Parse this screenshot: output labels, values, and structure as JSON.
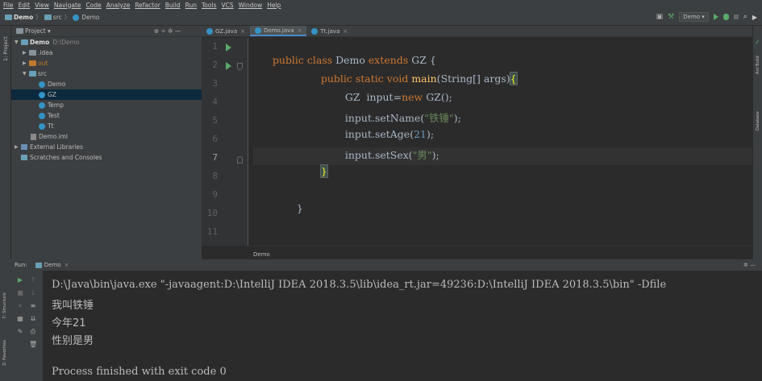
{
  "menu": [
    "File",
    "Edit",
    "View",
    "Navigate",
    "Code",
    "Analyze",
    "Refactor",
    "Build",
    "Run",
    "Tools",
    "VCS",
    "Window",
    "Help"
  ],
  "breadcrumb": {
    "project": "Demo",
    "folder": "src",
    "file": "Demo"
  },
  "toolbar": {
    "run_config": "Demo ▾"
  },
  "project_panel": {
    "title": "Project ▾",
    "icons": "⊕ ÷ ✲ —",
    "tree": [
      {
        "label": "Demo",
        "extra": "D:\\Demo"
      },
      {
        "label": ".idea"
      },
      {
        "label": "out"
      },
      {
        "label": "src"
      },
      {
        "label": "Demo"
      },
      {
        "label": "GZ"
      },
      {
        "label": "Temp"
      },
      {
        "label": "Test"
      },
      {
        "label": "Tt"
      },
      {
        "label": "Demo.iml"
      },
      {
        "label": "External Libraries"
      },
      {
        "label": "Scratches and Consoles"
      }
    ]
  },
  "left_tool_windows": {
    "project": "1: Project",
    "structure": "7: Structure",
    "favorites": "2: Favorites"
  },
  "right_tool_windows": {
    "ant": "Ant Build",
    "database": "Database"
  },
  "tabs": [
    {
      "label": "GZ.java"
    },
    {
      "label": "Demo.java",
      "active": true
    },
    {
      "label": "Tt.java"
    }
  ],
  "editor": {
    "line_numbers": [
      "1",
      "2",
      "3",
      "4",
      "5",
      "6",
      "7",
      "8",
      "9",
      "10",
      "11"
    ],
    "lines": {
      "l1_kw": "public class ",
      "l1_name": "Demo ",
      "l1_kw2": "extends ",
      "l1_rest": "GZ {",
      "l2_kw": "public static void ",
      "l2_fn": "main",
      "l2_args": "(String[] args)",
      "l2_brace": "{",
      "l3_a": "GZ  input=",
      "l3_kw": "new ",
      "l3_b": "GZ();",
      "l4_a": "input.setName(",
      "l4_str": "\"铁锤\"",
      "l4_b": ");",
      "l5_a": "input.setAge(",
      "l5_num": "21",
      "l5_b": ");",
      "l6_a": "input.setSex(",
      "l6_str": "\"男\"",
      "l6_b": ");",
      "l7_brace": "}",
      "l9": "}"
    },
    "breadcrumb": "Demo"
  },
  "run_panel": {
    "label": "Run:",
    "tab": "Demo",
    "settings": "✲ —"
  },
  "console": {
    "cmd": "D:\\Java\\bin\\java.exe \"-javaagent:D:\\IntelliJ IDEA 2018.3.5\\lib\\idea_rt.jar=49236:D:\\IntelliJ IDEA 2018.3.5\\bin\" -Dfile",
    "out1": "我叫铁锤",
    "out2": "今年21",
    "out3": "性别是男",
    "finish": "Process finished with exit code 0"
  }
}
